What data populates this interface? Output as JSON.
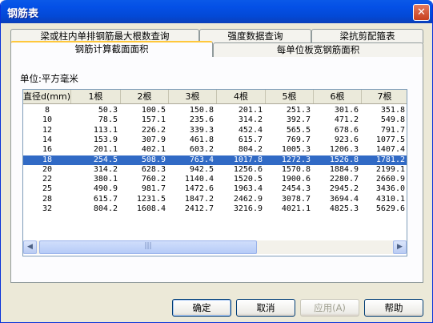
{
  "window": {
    "title": "钢筋表",
    "close_glyph": "✕"
  },
  "tabs": {
    "row1": [
      "梁或柱内单排钢筋最大根数查询",
      "强度数据查询",
      "梁抗剪配箍表"
    ],
    "row2": [
      "钢筋计算截面面积",
      "每单位板宽钢筋面积"
    ]
  },
  "unit_label": "单位:平方毫米",
  "table": {
    "columns": [
      "直径d(mm)",
      "1根",
      "2根",
      "3根",
      "4根",
      "5根",
      "6根",
      "7根"
    ],
    "rows": [
      [
        "8",
        "50.3",
        "100.5",
        "150.8",
        "201.1",
        "251.3",
        "301.6",
        "351.8"
      ],
      [
        "10",
        "78.5",
        "157.1",
        "235.6",
        "314.2",
        "392.7",
        "471.2",
        "549.8"
      ],
      [
        "12",
        "113.1",
        "226.2",
        "339.3",
        "452.4",
        "565.5",
        "678.6",
        "791.7"
      ],
      [
        "14",
        "153.9",
        "307.9",
        "461.8",
        "615.7",
        "769.7",
        "923.6",
        "1077.5"
      ],
      [
        "16",
        "201.1",
        "402.1",
        "603.2",
        "804.2",
        "1005.3",
        "1206.3",
        "1407.4"
      ],
      [
        "18",
        "254.5",
        "508.9",
        "763.4",
        "1017.8",
        "1272.3",
        "1526.8",
        "1781.2"
      ],
      [
        "20",
        "314.2",
        "628.3",
        "942.5",
        "1256.6",
        "1570.8",
        "1884.9",
        "2199.1"
      ],
      [
        "22",
        "380.1",
        "760.2",
        "1140.4",
        "1520.5",
        "1900.6",
        "2280.7",
        "2660.9"
      ],
      [
        "25",
        "490.9",
        "981.7",
        "1472.6",
        "1963.4",
        "2454.3",
        "2945.2",
        "3436.0"
      ],
      [
        "28",
        "615.7",
        "1231.5",
        "1847.2",
        "2462.9",
        "3078.7",
        "3694.4",
        "4310.1"
      ],
      [
        "32",
        "804.2",
        "1608.4",
        "2412.7",
        "3216.9",
        "4021.1",
        "4825.3",
        "5629.6"
      ]
    ],
    "selected_row_value": "18"
  },
  "scrollbar": {
    "left_arrow": "◀",
    "right_arrow": "▶",
    "grip": "|||"
  },
  "buttons": {
    "ok": "确定",
    "cancel": "取消",
    "apply": "应用(A)",
    "help": "帮助"
  }
}
